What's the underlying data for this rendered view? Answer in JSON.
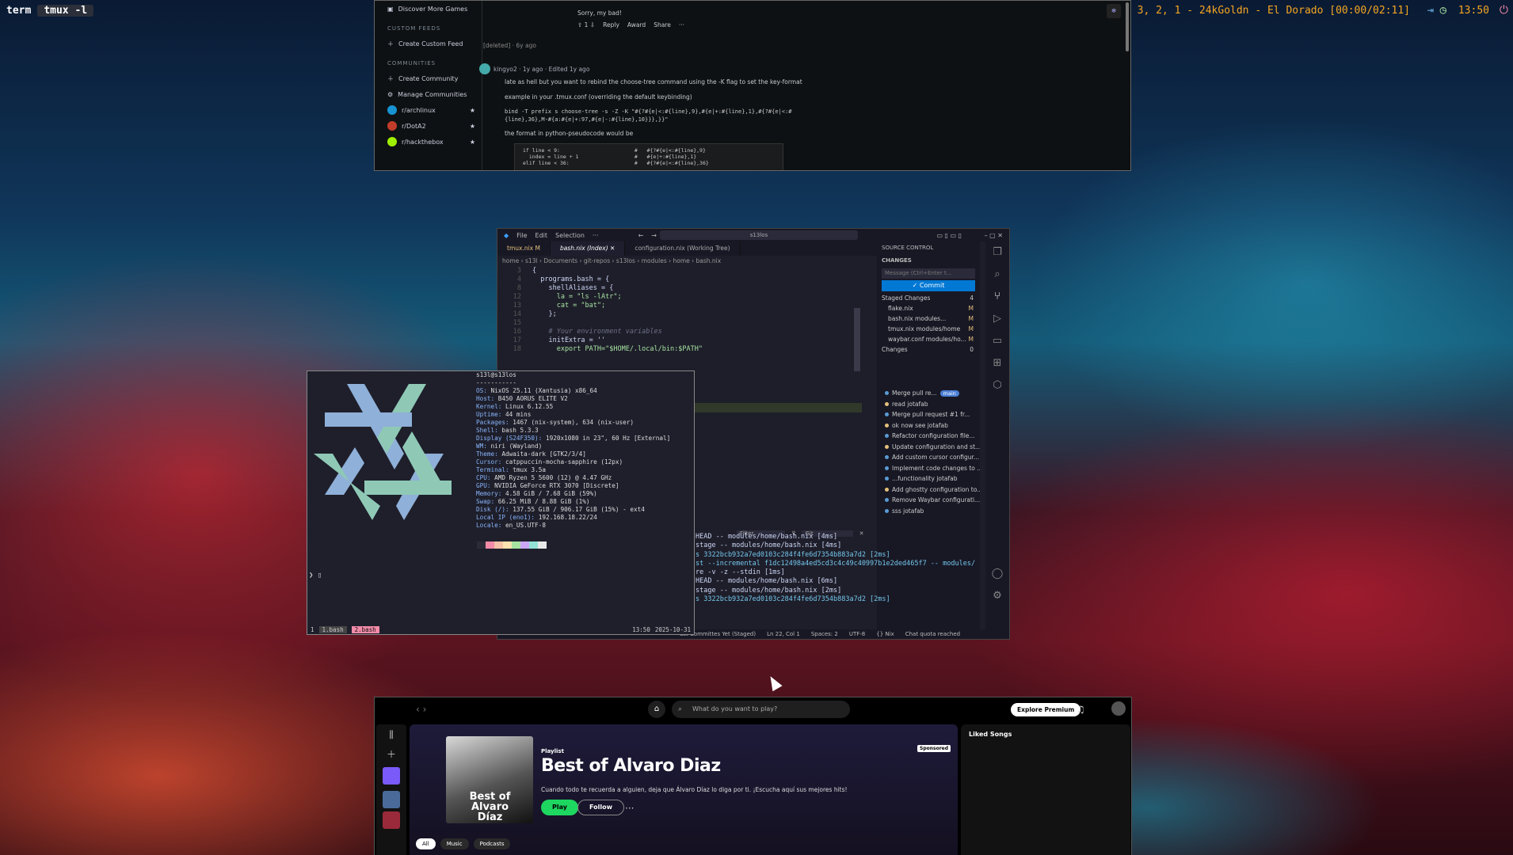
{
  "topbar": {
    "ws1": "term",
    "ws2": "tmux -l",
    "media": "▶ 3, 2, 1 - 24kGoldn - El Dorado [00:00/02:11]",
    "clock": "13:50"
  },
  "reddit": {
    "side": {
      "discover": "Discover More Games",
      "custom_feeds": "CUSTOM FEEDS",
      "create_feed": "Create Custom Feed",
      "communities": "COMMUNITIES",
      "create_community": "Create Community",
      "manage": "Manage Communities",
      "c1": "r/archlinux",
      "c2": "r/DotA2",
      "c3": "r/hackthebox"
    },
    "comment0": "Sorry, my bad!",
    "actions": {
      "reply": "Reply",
      "award": "Award",
      "share": "Share",
      "votes": "1"
    },
    "deleted": "[deleted] · 6y ago",
    "author": "kingyo2 · 1y ago · Edited 1y ago",
    "line1": "late as hell but you want to rebind the  choose-tree  command using the  -K  flag to set the  key-format",
    "line2": "example in your .tmux.conf (overriding the default keybinding)",
    "line3": "bind -T prefix s choose-tree -s -Z -K \"#{?#{e|<:#{line},9},#{e|+:#{line},1},#{?#{e|<:#",
    "line4": "{line},36},M-#{a:#{e|+:97,#{e|-:#{line},10}}},}}\"",
    "line5": "the format in python-pseudocode would be",
    "code": "if line < 9:                        #   #{?#{e|<:#{line},9}\n  index = line + 1                  #   #{e|+:#{line},1}\nelif line < 36:                     #   #{?#{e|<:#{line},36}"
  },
  "vscode": {
    "menu": [
      "File",
      "Edit",
      "Selection",
      "···"
    ],
    "search": "s13los",
    "tabs": [
      "tmux.nix  M",
      "bash.nix (Index)",
      "configuration.nix (Working Tree)"
    ],
    "crumb": "home › s13l › Documents › git-repos › s13los › modules › home › bash.nix",
    "code": [
      {
        "n": "3",
        "t": "{"
      },
      {
        "n": "4",
        "t": "  programs.bash = {"
      },
      {
        "n": "8",
        "t": "    shellAliases = {"
      },
      {
        "n": "12",
        "t": "      la = \"ls -lAtr\";"
      },
      {
        "n": "13",
        "t": "      cat = \"bat\";"
      },
      {
        "n": "14",
        "t": "    };"
      },
      {
        "n": "15",
        "t": ""
      },
      {
        "n": "16",
        "t": "    # Your environment variables"
      },
      {
        "n": "17",
        "t": "    initExtra = ''"
      },
      {
        "n": "18",
        "t": "      export PATH=\"$HOME/.local/bin:$PATH\""
      }
    ],
    "sc": {
      "title": "SOURCE CONTROL",
      "changes_hdr": "CHANGES",
      "msg": "Message (Ctrl+Enter t...",
      "commit": "✓ Commit",
      "staged": "Staged Changes",
      "staged_count": "4",
      "files": [
        {
          "n": "flake.nix",
          "s": "M"
        },
        {
          "n": "bash.nix  modules...",
          "s": "M"
        },
        {
          "n": "tmux.nix  modules/home",
          "s": "M"
        },
        {
          "n": "waybar.conf  modules/ho...",
          "s": "M"
        }
      ],
      "changes": "Changes",
      "changes_count": "0",
      "graph": [
        "Merge pull re...",
        "read  jotafab",
        "Merge pull request #1 fr...",
        "ok now see  jotafab",
        "Refactor configuration file...",
        "Update configuration and st...",
        "Add custom cursor configur...",
        "Implement code changes to ...",
        "...functionality  jotafab",
        "Add ghostty configuration to...",
        "Remove Waybar configurati...",
        "sss  jotafab"
      ],
      "branch": "main"
    },
    "filter": "Filter",
    "git": "Git",
    "term": [
      "HEAD -- modules/home/bash.nix [4ms]",
      "stage -- modules/home/bash.nix [4ms]",
      "s 3322bcb932a7ed0103c284f4fe6d7354b883a7d2 [2ms]",
      "st --incremental f1dc12498a4ed5cd3c4c49c40997b1e2ded465f7 -- modules/",
      "",
      "re -v -z --stdin [1ms]",
      "HEAD -- modules/home/bash.nix [6ms]",
      "stage -- modules/home/bash.nix [2ms]",
      "s 3322bcb932a7ed0103c284f4fe6d7354b883a7d2 [2ms]"
    ],
    "status": [
      "ast Committes Yet (Staged)",
      "Ln 22, Col 1",
      "Spaces: 2",
      "UTF-8",
      "{} Nix",
      "Chat quota reached"
    ]
  },
  "fetch": {
    "lines": [
      [
        "",
        "s13l@s13los"
      ],
      [
        "",
        "-----------"
      ],
      [
        "OS:",
        "NixOS 25.11 (Xantusia) x86_64"
      ],
      [
        "Host:",
        "B450 AORUS ELITE V2"
      ],
      [
        "Kernel:",
        "Linux 6.12.55"
      ],
      [
        "Uptime:",
        "44 mins"
      ],
      [
        "Packages:",
        "1467 (nix-system), 634 (nix-user)"
      ],
      [
        "Shell:",
        "bash 5.3.3"
      ],
      [
        "Display (S24F350):",
        "1920x1080 in 23\", 60 Hz [External]"
      ],
      [
        "WM:",
        "niri (Wayland)"
      ],
      [
        "Theme:",
        "Adwaita-dark [GTK2/3/4]"
      ],
      [
        "Cursor:",
        "catppuccin-mocha-sapphire (12px)"
      ],
      [
        "Terminal:",
        "tmux 3.5a"
      ],
      [
        "CPU:",
        "AMD Ryzen 5 5600 (12) @ 4.47 GHz"
      ],
      [
        "GPU:",
        "NVIDIA GeForce RTX 3070 [Discrete]"
      ],
      [
        "Memory:",
        "4.58 GiB / 7.68 GiB (59%)"
      ],
      [
        "Swap:",
        "66.25 MiB / 8.88 GiB (1%)"
      ],
      [
        "Disk (/):",
        "137.55 GiB / 906.17 GiB (15%) - ext4"
      ],
      [
        "Local IP (eno1):",
        "192.168.18.22/24"
      ],
      [
        "Locale:",
        "en_US.UTF-8"
      ]
    ],
    "prompt": "❯ ▯",
    "tmux": {
      "session": "1",
      "w1": "1.bash",
      "w2": "2.bash",
      "time": "13:50",
      "date": "2025-10-31"
    },
    "colors": [
      "#2b2b38",
      "#f38ba8",
      "#f5c2a8",
      "#f9e2af",
      "#a6e3a1",
      "#cba6f7",
      "#94e2d5",
      "#e8e8e8"
    ]
  },
  "spotify": {
    "search": "What do you want to play?",
    "premium": "Explore Premium",
    "playlist": "Playlist",
    "title": "Best of Alvaro Diaz",
    "desc": "Cuando todo te recuerda a alguien, deja que Álvaro Díaz lo diga por ti. ¡Escucha aquí sus mejores hits!",
    "play": "Play",
    "follow": "Follow",
    "sponsored": "Sponsored",
    "art_text": "Best of Alvaro Díaz",
    "chips": [
      "All",
      "Music",
      "Podcasts"
    ],
    "liked": "Liked Songs"
  }
}
